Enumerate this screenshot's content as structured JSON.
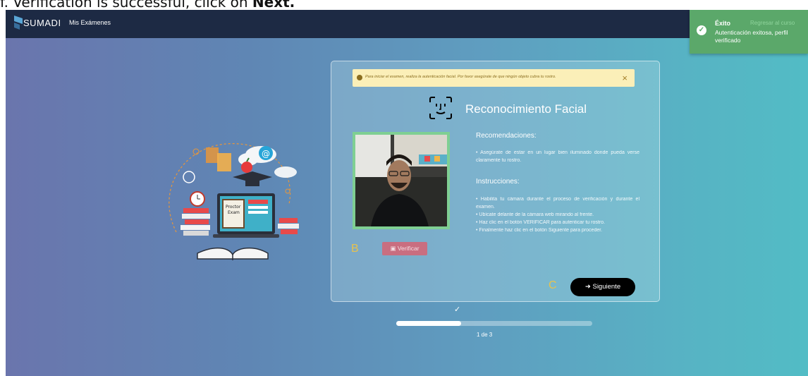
{
  "caption": {
    "prefix": "f. Verification is successful, click on ",
    "emphasis": "Next."
  },
  "header": {
    "brand": "SUMADI",
    "nav_link": "Mis Exámenes"
  },
  "toast": {
    "title": "Éxito",
    "link": "Regresar al curso",
    "message": "Autenticación exitosa, perfil verificado",
    "icon": "check-circle-icon",
    "color": "#5ba86a"
  },
  "alert": {
    "text": "Para iniciar el examen, realiza la autenticación facial. Por favor asegúrate de que ningún objeto cubra tu rostro.",
    "close": "×"
  },
  "card": {
    "title": "Reconocimiento Facial",
    "recommendations_heading": "Recomendaciones:",
    "recommendations_text": "• Asegúrate de estar en un lugar bien iluminado donde pueda verse claramente tu rostro.",
    "instructions_heading": "Instrucciones:",
    "instructions": [
      "• Habilita tu cámara durante el proceso de verificación y durante el examen.",
      "• Ubícate delante de la cámara web mirando al frente.",
      "• Haz clic en el botón VERIFICAR para autenticar tu rostro.",
      "• Finalmente haz clic en el botón Siguiente para proceder."
    ],
    "verify_button": "Verificar",
    "next_button": "Siguiente",
    "annotation_b": "B",
    "annotation_c": "C"
  },
  "progress": {
    "check": "✓",
    "value": 0.33,
    "step_label": "1 de 3"
  },
  "colors": {
    "topbar": "#1d2a44",
    "next_button": "#000000",
    "verify_button": "#c96e80",
    "alert_bg": "#fbefb8",
    "annotation": "#e8c24d"
  }
}
